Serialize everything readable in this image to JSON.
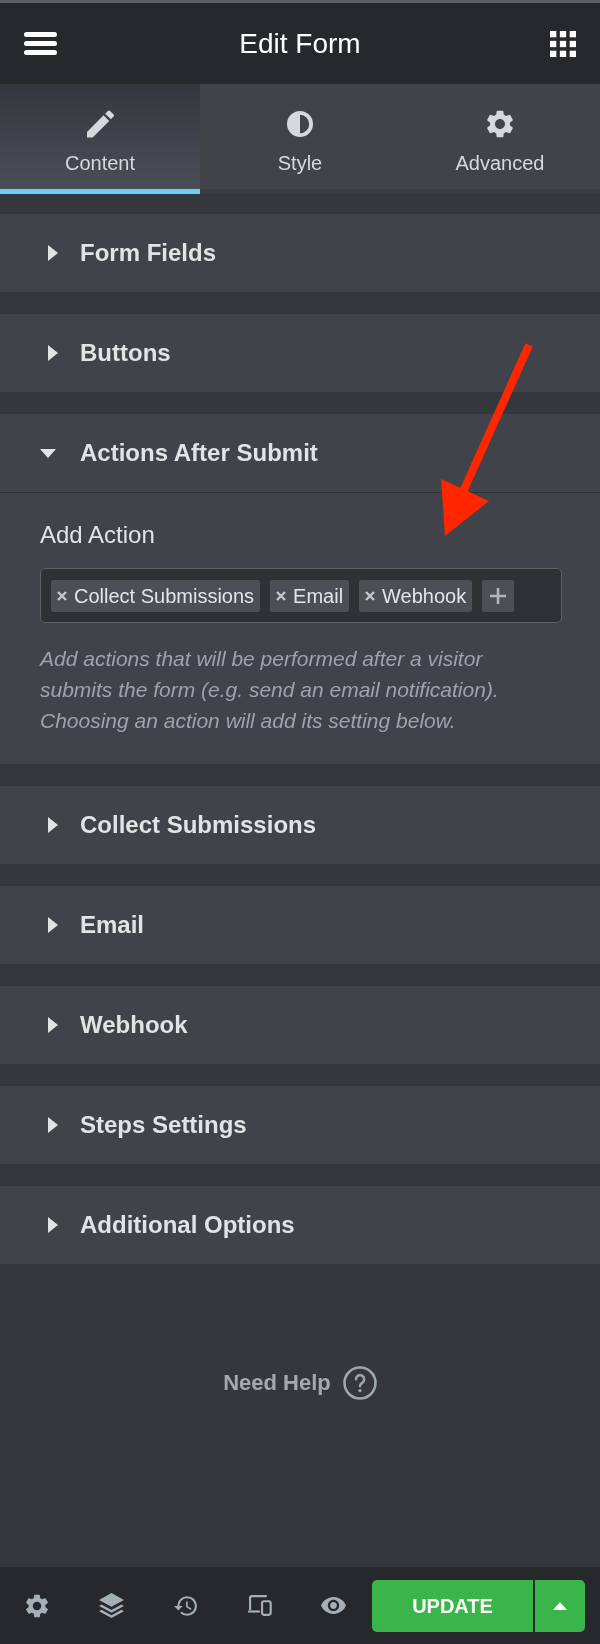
{
  "header": {
    "title": "Edit Form"
  },
  "tabs": [
    {
      "label": "Content",
      "selected": true
    },
    {
      "label": "Style",
      "selected": false
    },
    {
      "label": "Advanced",
      "selected": false
    }
  ],
  "sections": [
    {
      "title": "Form Fields",
      "expanded": false
    },
    {
      "title": "Buttons",
      "expanded": false
    },
    {
      "title": "Actions After Submit",
      "expanded": true,
      "field": {
        "label": "Add Action",
        "tags": [
          "Collect Submissions",
          "Email",
          "Webhook"
        ],
        "description": "Add actions that will be performed after a visitor submits the form (e.g. send an email notification). Choosing an action will add its setting below."
      }
    },
    {
      "title": "Collect Submissions",
      "expanded": false
    },
    {
      "title": "Email",
      "expanded": false
    },
    {
      "title": "Webhook",
      "expanded": false
    },
    {
      "title": "Steps Settings",
      "expanded": false
    },
    {
      "title": "Additional Options",
      "expanded": false
    }
  ],
  "help": {
    "label": "Need Help"
  },
  "footer": {
    "update_button": "UPDATE"
  },
  "annotation": {
    "kind": "arrow"
  }
}
